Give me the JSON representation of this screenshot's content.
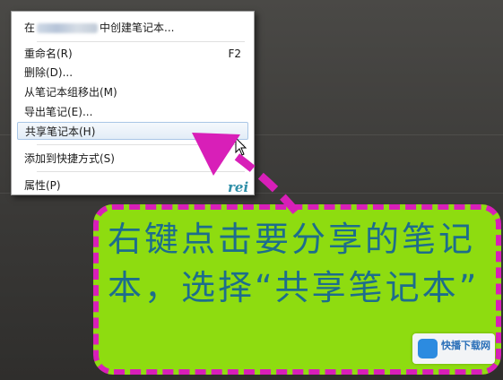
{
  "menu": {
    "items": [
      {
        "prefix": "在",
        "suffix": "中创建笔记本...",
        "shortcut": ""
      },
      {
        "label": "重命名(R)",
        "shortcut": "F2"
      },
      {
        "label": "删除(D)..."
      },
      {
        "label": "从笔记本组移出(M)"
      },
      {
        "label": "导出笔记(E)..."
      },
      {
        "label": "共享笔记本(H)"
      },
      {
        "label": "添加到快捷方式(S)"
      },
      {
        "label": "属性(P)"
      }
    ],
    "selected_index": 5
  },
  "watermark": "rei",
  "callout": {
    "text": "右键点击要分享的笔记本，选择“共享笔记本”"
  },
  "logo": {
    "name": "快播下载网"
  },
  "colors": {
    "callout_bg": "#8edc10",
    "callout_border": "#d81fb8",
    "callout_text": "#1d6d8c",
    "arrow": "#d81fb8"
  }
}
